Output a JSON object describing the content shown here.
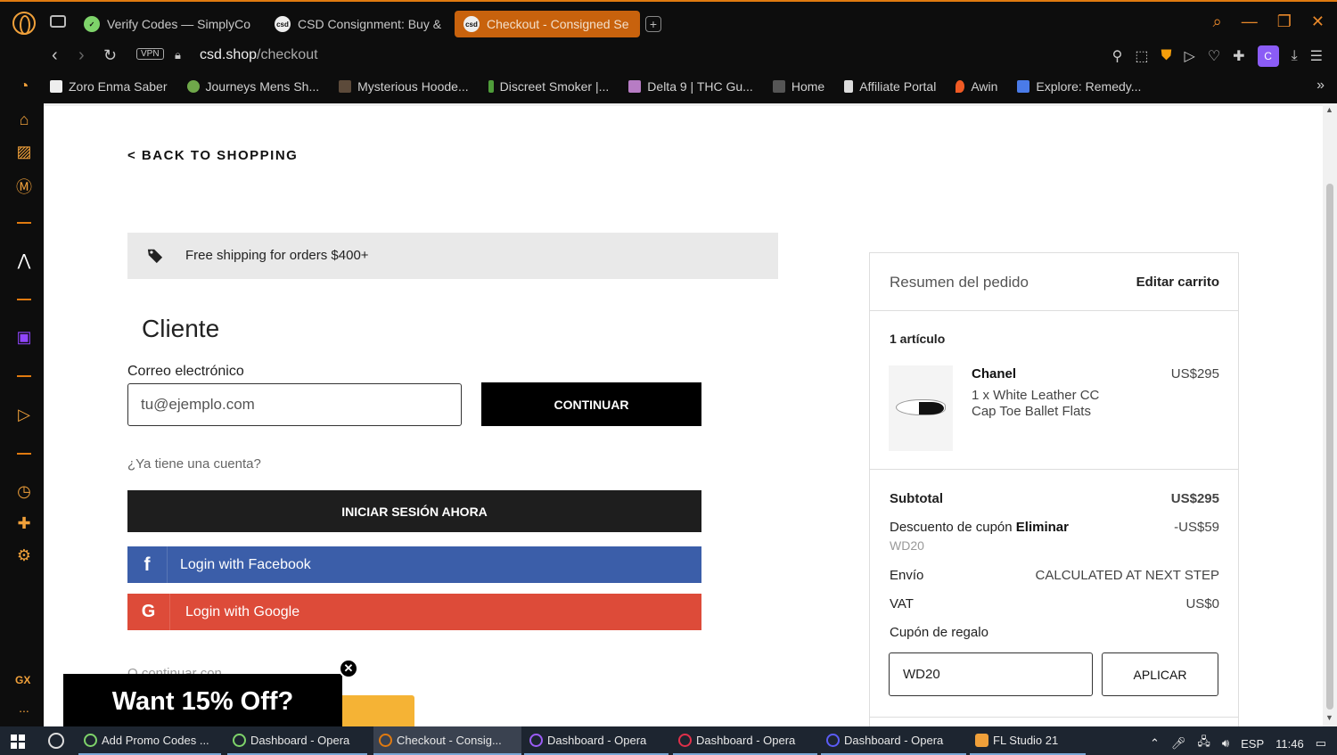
{
  "browser": {
    "tabs": [
      {
        "label": "Verify Codes — SimplyCo",
        "favicon": "check-icon"
      },
      {
        "label": "CSD Consignment: Buy &",
        "favicon": "csd-icon"
      },
      {
        "label": "Checkout - Consigned Se",
        "favicon": "csd-icon",
        "active": true
      }
    ],
    "vpn_label": "VPN",
    "url_host": "csd.shop",
    "url_path": "/checkout",
    "profile_initial": "C",
    "bookmarks": [
      "Zoro Enma Saber",
      "Journeys Mens Sh...",
      "Mysterious Hoode...",
      "Discreet Smoker |...",
      "Delta 9 | THC Gu...",
      "Home",
      "Affiliate Portal",
      "Awin",
      "Explore: Remedy..."
    ],
    "sidebar_gx": "GX",
    "sidebar_more": "..."
  },
  "checkout": {
    "back_link": "< BACK TO SHOPPING",
    "shipping_banner": "Free shipping for orders $400+",
    "customer_title": "Cliente",
    "email_label": "Correo electrónico",
    "email_placeholder": "tu@ejemplo.com",
    "continue_button": "CONTINUAR",
    "have_account": "¿Ya tiene una cuenta?",
    "login_button": "INICIAR SESIÓN AHORA",
    "facebook_button": "Login with Facebook",
    "google_button": "Login with Google",
    "continue_with": "O continuar con",
    "promo_popup": "Want 15% Off?"
  },
  "summary": {
    "title": "Resumen del pedido",
    "edit_cart": "Editar carrito",
    "items_count": "1 artículo",
    "product": {
      "brand": "Chanel",
      "name": "1 x White Leather CC Cap Toe Ballet Flats",
      "price": "US$295"
    },
    "subtotal_label": "Subtotal",
    "subtotal_value": "US$295",
    "coupon_label": "Descuento de cupón",
    "coupon_remove": "Eliminar",
    "coupon_value": "-US$59",
    "coupon_code": "WD20",
    "shipping_label": "Envío",
    "shipping_value": "CALCULATED AT NEXT STEP",
    "vat_label": "VAT",
    "vat_value": "US$0",
    "gift_label": "Cupón de regalo",
    "gift_input_value": "WD20",
    "apply_button": "APLICAR"
  },
  "taskbar": {
    "items": [
      "Add Promo Codes ...",
      "Dashboard - Opera",
      "Checkout - Consig...",
      "Dashboard - Opera",
      "Dashboard - Opera",
      "Dashboard - Opera",
      "FL Studio 21"
    ],
    "language": "ESP",
    "time": "11:46"
  }
}
